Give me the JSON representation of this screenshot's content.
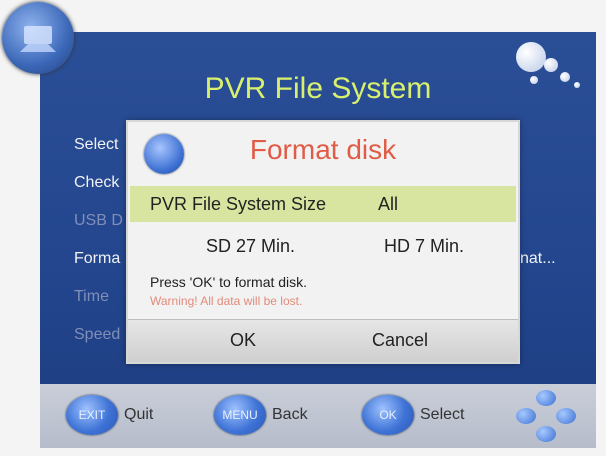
{
  "screen": {
    "title": "PVR File System",
    "menu_items": [
      "Select",
      "Check",
      "USB D",
      "Forma",
      "Time",
      "Speed"
    ],
    "right_fragment": "nat..."
  },
  "dialog": {
    "title": "Format disk",
    "size_label": "PVR File System Size",
    "size_value": "All",
    "sd_time": "SD 27 Min.",
    "hd_time": "HD 7 Min.",
    "instruction": "Press 'OK' to format disk.",
    "warning": "Warning! All data will be lost.",
    "ok_label": "OK",
    "cancel_label": "Cancel"
  },
  "footer": {
    "exit_badge": "EXIT",
    "exit_label": "Quit",
    "menu_badge": "MENU",
    "menu_label": "Back",
    "ok_badge": "OK",
    "ok_label": "Select"
  },
  "colors": {
    "title_yellow": "#d8f06e",
    "dialog_title": "#e05c46",
    "highlight": "#d8e5a0",
    "screen_blue": "#2b4f97"
  }
}
